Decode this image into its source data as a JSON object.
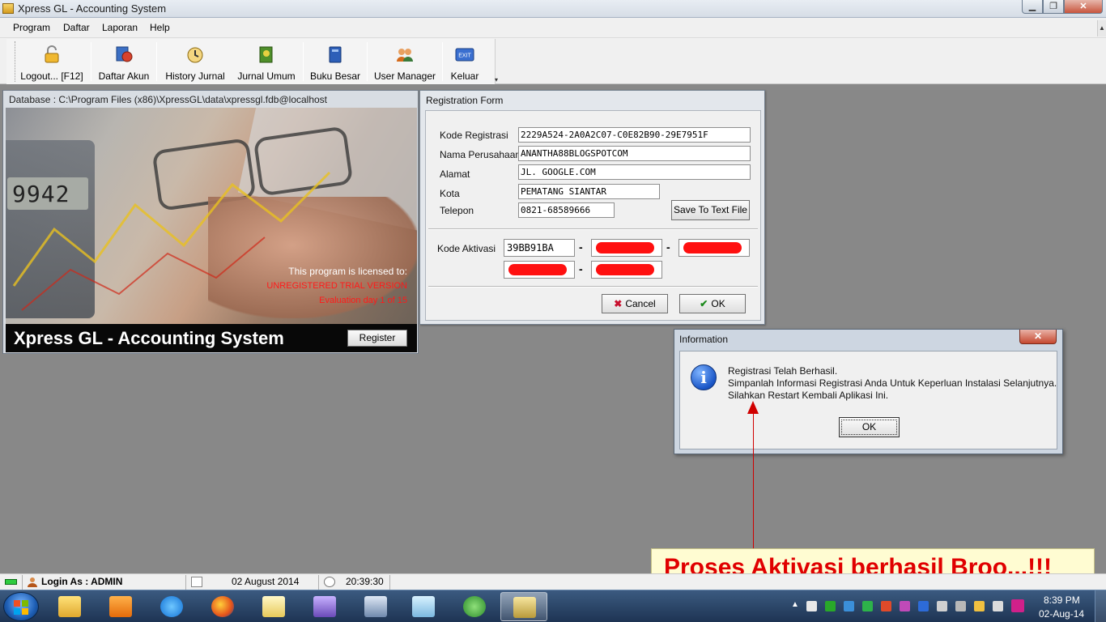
{
  "window": {
    "title": "Xpress GL - Accounting System",
    "min_glyph": "▁",
    "max_glyph": "❐",
    "close_glyph": "✕"
  },
  "menu": {
    "items": [
      "Program",
      "Daftar",
      "Laporan",
      "Help"
    ],
    "scroll_glyph": "▲"
  },
  "toolbar": {
    "buttons": [
      {
        "label": "Logout...  [F12]",
        "icon": "padlock-icon"
      },
      {
        "label": "Daftar Akun",
        "icon": "accounts-globe-icon"
      },
      {
        "label": "History Jurnal",
        "icon": "history-clock-icon"
      },
      {
        "label": "Jurnal Umum",
        "icon": "journal-book-icon"
      },
      {
        "label": "Buku Besar",
        "icon": "ledger-book-icon"
      },
      {
        "label": "User Manager",
        "icon": "users-icon"
      },
      {
        "label": "Keluar",
        "icon": "exit-icon"
      }
    ],
    "exit_icon_text": "EXIT",
    "overflow_glyph": "▾"
  },
  "splash": {
    "title": "Database : C:\\Program Files (x86)\\XpressGL\\data\\xpressgl.fdb@localhost",
    "calculator_display": "9942",
    "license_label": "This program is licensed to:",
    "license_version": "UNREGISTERED TRIAL VERSION",
    "evaluation": "Evaluation day 1 of 15",
    "app_name": "Xpress GL - Accounting System",
    "register_label": "Register"
  },
  "registration": {
    "title": "Registration Form",
    "fields": [
      {
        "label": "Kode Registrasi",
        "value": "2229A524-2A0A2C07-C0E82B90-29E7951F"
      },
      {
        "label": "Nama Perusahaan",
        "value": "ANANTHA88BLOGSPOTCOM"
      },
      {
        "label": "Alamat",
        "value": "JL. GOOGLE.COM"
      },
      {
        "label": "Kota",
        "value": "PEMATANG SIANTAR"
      },
      {
        "label": "Telepon",
        "value": "0821-68589666"
      }
    ],
    "save_label": "Save To Text File",
    "activation_label": "Kode Aktivasi",
    "activation_first": "39BB91BA",
    "dash": "-",
    "cancel_label": "Cancel",
    "ok_label": "OK",
    "cancel_glyph": "✖",
    "ok_glyph": "✔",
    "redaction_color": "#ff1010"
  },
  "info_dialog": {
    "title": "Information",
    "close_glyph": "✕",
    "icon_glyph": "i",
    "lines": [
      "Registrasi Telah Berhasil.",
      "Simpanlah Informasi Registrasi Anda Untuk Keperluan Instalasi Selanjutnya.",
      "Silahkan Restart Kembali Aplikasi Ini."
    ],
    "ok_label": "OK"
  },
  "annotation": {
    "text": "Proses Aktivasi berhasil Broo...!!!",
    "color": "#e00000"
  },
  "statusbar": {
    "login": "Login As : ADMIN",
    "date": "02 August 2014",
    "time": "20:39:30"
  },
  "taskbar": {
    "time": "8:39 PM",
    "date": "02-Aug-14",
    "tray_expand_glyph": "▲",
    "apps": [
      "file-explorer-icon",
      "media-player-icon",
      "internet-explorer-icon",
      "firefox-icon",
      "notepad-icon",
      "presentation-icon",
      "window-manager-icon",
      "sticky-notes-icon",
      "globe-network-icon",
      "xpress-gl-icon"
    ]
  }
}
